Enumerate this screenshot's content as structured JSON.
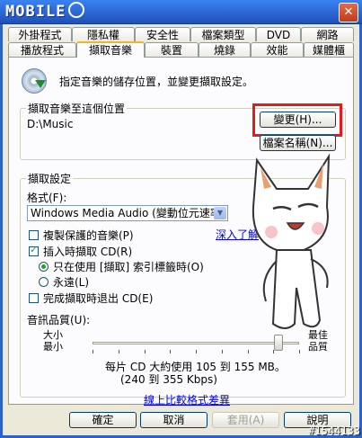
{
  "window": {
    "logo_text": "MOBILE",
    "close_glyph": "✕"
  },
  "tabs": {
    "row_top": [
      "外掛程式",
      "隱私權",
      "安全性",
      "檔案類型",
      "DVD",
      "網路"
    ],
    "row_bottom": [
      "播放程式",
      "擷取音樂",
      "裝置",
      "燒錄",
      "效能",
      "媒體櫃"
    ],
    "active": "擷取音樂"
  },
  "intro": "指定音樂的儲存位置，並變更擷取設定。",
  "location": {
    "legend": "擷取音樂至這個位置",
    "path": "D:\\Music",
    "change_button": "變更(H)...",
    "filename_button": "檔案名稱(N)..."
  },
  "settings": {
    "legend": "擷取設定",
    "format_label": "格式(F):",
    "format_value": "Windows Media Audio (變動位元速率)",
    "learn_more": "深入了解",
    "copy_protect": "複製保護的音樂(P)",
    "copy_protect_checked": false,
    "rip_on_insert": "插入時擷取 CD(R)",
    "rip_on_insert_checked": true,
    "radio_only_tab": "只在使用 [擷取] 索引標籤時(O)",
    "radio_always": "永遠(L)",
    "radio_selected": "only_tab",
    "eject": "完成擷取時退出 CD(E)",
    "eject_checked": false,
    "quality_label": "音訊品質(U):",
    "min_top": "大小",
    "min_bottom": "最小",
    "max_top": "最佳",
    "max_bottom": "品質",
    "quality_value": 0.9,
    "usage_line1": "每片 CD 大約使用 105 到 155 MB。",
    "usage_line2": "(240 到 355 Kbps)",
    "compare_link": "線上比較格式差異"
  },
  "footer": {
    "ok": "確定",
    "cancel": "取消",
    "apply": "套用(A)",
    "help": "說明"
  },
  "watermark": "#1544133",
  "colors": {
    "highlight_box": "#e51a1a",
    "title_bar": "#2d63c8",
    "dialog_bg": "#ece9d8"
  }
}
